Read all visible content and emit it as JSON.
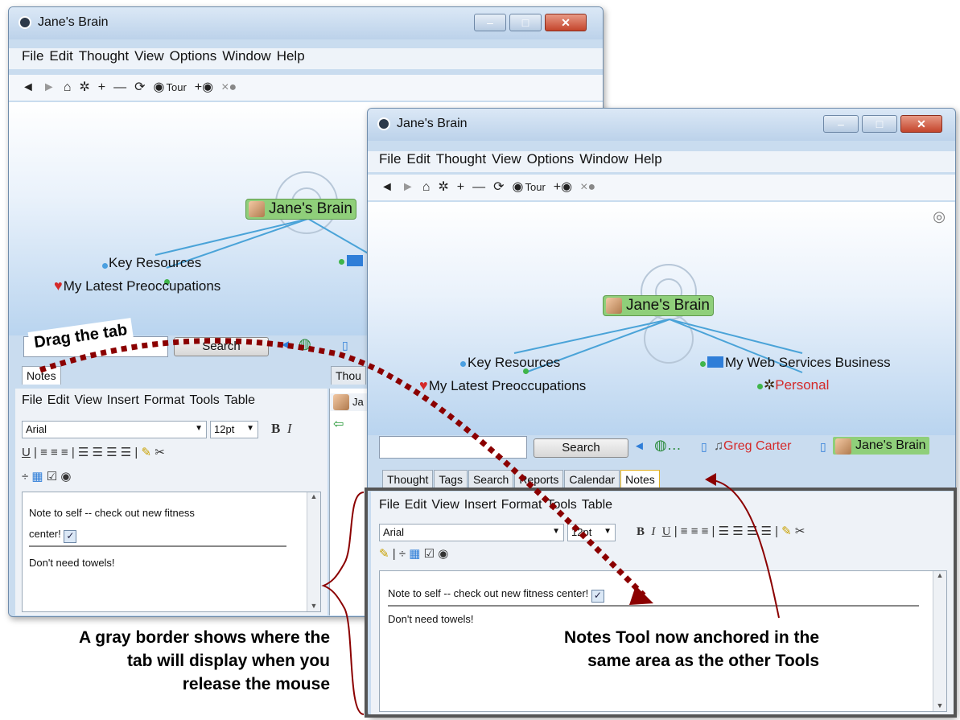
{
  "back_window": {
    "title": "Jane's Brain",
    "menu": [
      "File",
      "Edit",
      "Thought",
      "View",
      "Options",
      "Window",
      "Help"
    ],
    "toolbar": {
      "tour_label": "Tour"
    },
    "nodes": {
      "central": "Jane's Brain",
      "key": "Key Resources",
      "latest": "My Latest Preoccupations"
    },
    "search_button": "Search",
    "tabs": [
      "Notes",
      "Thou"
    ],
    "notes_menu": [
      "File",
      "Edit",
      "View",
      "Insert",
      "Format",
      "Tools",
      "Table"
    ],
    "font": "Arial",
    "size": "12pt",
    "note_line1": "Note to self -- check out new fitness",
    "note_line2": "center!",
    "note_line3": "Don't need towels!",
    "thought_partial": "Ja"
  },
  "front_window": {
    "title": "Jane's Brain",
    "menu": [
      "File",
      "Edit",
      "Thought",
      "View",
      "Options",
      "Window",
      "Help"
    ],
    "toolbar": {
      "tour_label": "Tour"
    },
    "nodes": {
      "central": "Jane's Brain",
      "key": "Key Resources",
      "latest": "My Latest Preoccupations",
      "web": "My Web Services Business",
      "personal": "Personal"
    },
    "search_button": "Search",
    "breadcrumbs": [
      "Greg Carter",
      "Jane's Brain"
    ],
    "tabs": [
      "Thought",
      "Tags",
      "Search",
      "Reports",
      "Calendar",
      "Notes"
    ],
    "notes_menu": [
      "File",
      "Edit",
      "View",
      "Insert",
      "Format",
      "Tools",
      "Table"
    ],
    "font": "Arial",
    "size": "12pt",
    "note_line1": "Note to self -- check out new fitness center!",
    "note_line2": "Don't need towels!"
  },
  "callouts": {
    "drag": "Drag the tab",
    "gray_border": [
      "A gray border shows where the",
      "tab will display when you",
      "release the mouse"
    ],
    "anchored": [
      "Notes Tool now anchored in the",
      "same area as the other Tools"
    ]
  },
  "colors": {
    "accent_red": "#d42a2a",
    "central_green": "#8fcf7a",
    "drag_path": "#8b0000",
    "gray_border": "#555555"
  }
}
